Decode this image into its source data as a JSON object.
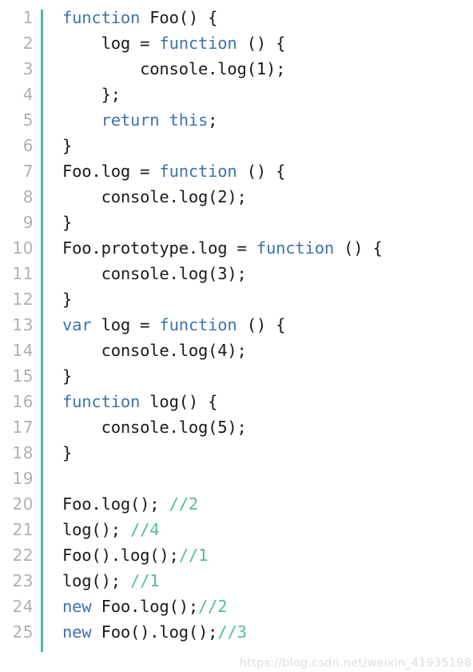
{
  "editor": {
    "language": "javascript",
    "total_lines": 25,
    "colors": {
      "background": "#ffffff",
      "text": "#1a1a1a",
      "keyword": "#3f72ad",
      "comment": "#4fbe9a",
      "line_number": "#b0b0b0",
      "gutter_separator": "#4fba97",
      "watermark": "#dedede"
    }
  },
  "watermark": {
    "text": "https://blog.csdn.net/weixin_41935198"
  },
  "lines": [
    {
      "number": "1",
      "tokens": [
        {
          "t": "function",
          "k": "keyword"
        },
        {
          "t": " Foo() {",
          "k": "plain"
        }
      ]
    },
    {
      "number": "2",
      "tokens": [
        {
          "t": "    log = ",
          "k": "plain"
        },
        {
          "t": "function",
          "k": "keyword"
        },
        {
          "t": " () {",
          "k": "plain"
        }
      ]
    },
    {
      "number": "3",
      "tokens": [
        {
          "t": "        console.log(1);",
          "k": "plain"
        }
      ]
    },
    {
      "number": "4",
      "tokens": [
        {
          "t": "    };",
          "k": "plain"
        }
      ]
    },
    {
      "number": "5",
      "tokens": [
        {
          "t": "    ",
          "k": "plain"
        },
        {
          "t": "return",
          "k": "keyword"
        },
        {
          "t": " ",
          "k": "plain"
        },
        {
          "t": "this",
          "k": "keyword"
        },
        {
          "t": ";",
          "k": "plain"
        }
      ]
    },
    {
      "number": "6",
      "tokens": [
        {
          "t": "}",
          "k": "plain"
        }
      ]
    },
    {
      "number": "7",
      "tokens": [
        {
          "t": "Foo.log = ",
          "k": "plain"
        },
        {
          "t": "function",
          "k": "keyword"
        },
        {
          "t": " () {",
          "k": "plain"
        }
      ]
    },
    {
      "number": "8",
      "tokens": [
        {
          "t": "    console.log(2);",
          "k": "plain"
        }
      ]
    },
    {
      "number": "9",
      "tokens": [
        {
          "t": "}",
          "k": "plain"
        }
      ]
    },
    {
      "number": "10",
      "tokens": [
        {
          "t": "Foo.prototype.log = ",
          "k": "plain"
        },
        {
          "t": "function",
          "k": "keyword"
        },
        {
          "t": " () {",
          "k": "plain"
        }
      ]
    },
    {
      "number": "11",
      "tokens": [
        {
          "t": "    console.log(3);",
          "k": "plain"
        }
      ]
    },
    {
      "number": "12",
      "tokens": [
        {
          "t": "}",
          "k": "plain"
        }
      ]
    },
    {
      "number": "13",
      "tokens": [
        {
          "t": "var",
          "k": "keyword"
        },
        {
          "t": " log = ",
          "k": "plain"
        },
        {
          "t": "function",
          "k": "keyword"
        },
        {
          "t": " () {",
          "k": "plain"
        }
      ]
    },
    {
      "number": "14",
      "tokens": [
        {
          "t": "    console.log(4);",
          "k": "plain"
        }
      ]
    },
    {
      "number": "15",
      "tokens": [
        {
          "t": "}",
          "k": "plain"
        }
      ]
    },
    {
      "number": "16",
      "tokens": [
        {
          "t": "function",
          "k": "keyword"
        },
        {
          "t": " log() {",
          "k": "plain"
        }
      ]
    },
    {
      "number": "17",
      "tokens": [
        {
          "t": "    console.log(5);",
          "k": "plain"
        }
      ]
    },
    {
      "number": "18",
      "tokens": [
        {
          "t": "}",
          "k": "plain"
        }
      ]
    },
    {
      "number": "19",
      "tokens": []
    },
    {
      "number": "20",
      "tokens": [
        {
          "t": "Foo.log(); ",
          "k": "plain"
        },
        {
          "t": "//2",
          "k": "comment"
        }
      ]
    },
    {
      "number": "21",
      "tokens": [
        {
          "t": "log(); ",
          "k": "plain"
        },
        {
          "t": "//4",
          "k": "comment"
        }
      ]
    },
    {
      "number": "22",
      "tokens": [
        {
          "t": "Foo().log();",
          "k": "plain"
        },
        {
          "t": "//1",
          "k": "comment"
        }
      ]
    },
    {
      "number": "23",
      "tokens": [
        {
          "t": "log(); ",
          "k": "plain"
        },
        {
          "t": "//1",
          "k": "comment"
        }
      ]
    },
    {
      "number": "24",
      "tokens": [
        {
          "t": "new",
          "k": "keyword"
        },
        {
          "t": " Foo.log();",
          "k": "plain"
        },
        {
          "t": "//2",
          "k": "comment"
        }
      ]
    },
    {
      "number": "25",
      "tokens": [
        {
          "t": "new",
          "k": "keyword"
        },
        {
          "t": " Foo().log();",
          "k": "plain"
        },
        {
          "t": "//3",
          "k": "comment"
        }
      ]
    }
  ]
}
